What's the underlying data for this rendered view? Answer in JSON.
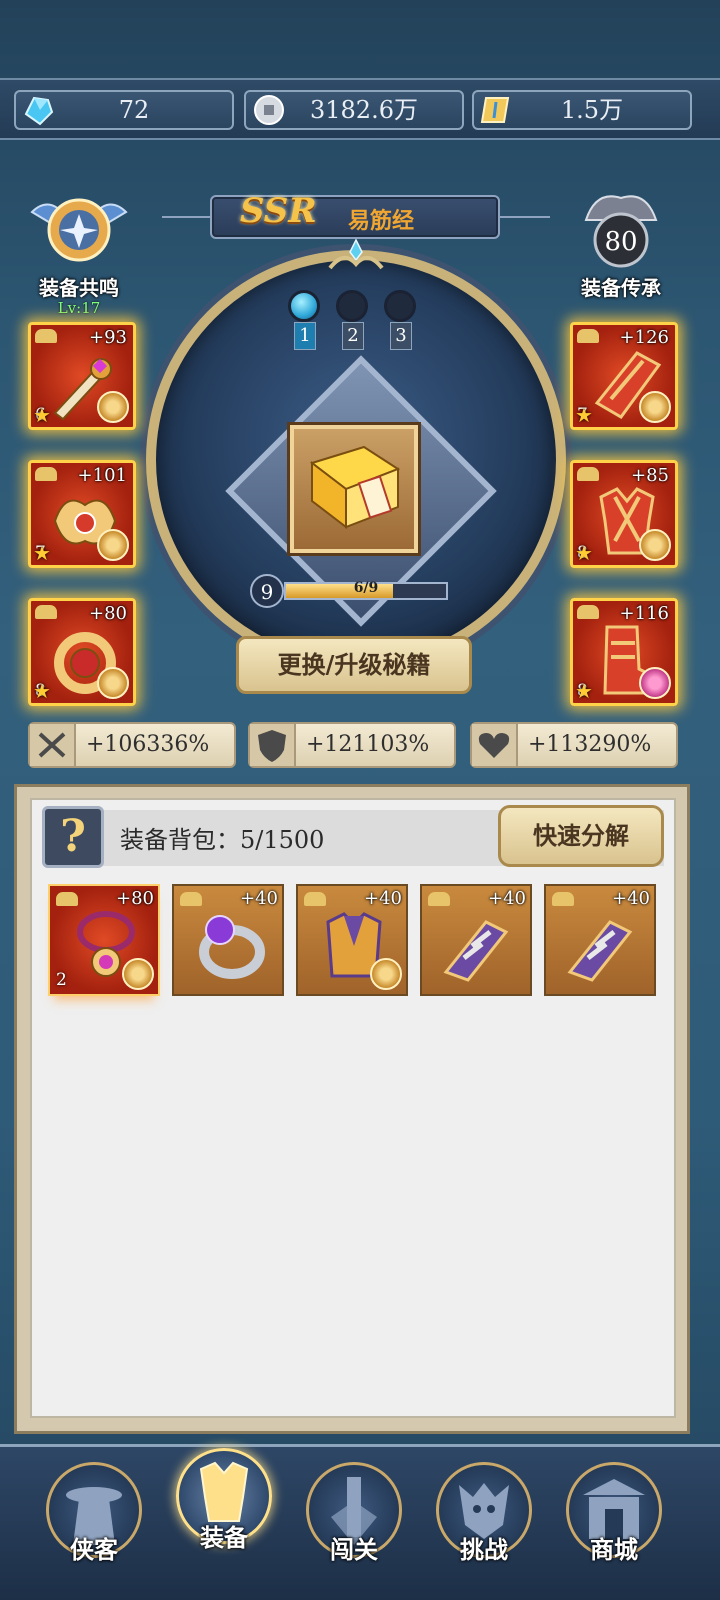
{
  "currencies": [
    {
      "icon": "blue-crystal-icon",
      "value": "72"
    },
    {
      "icon": "silver-coin-icon",
      "value": "3182.6万"
    },
    {
      "icon": "gold-scroll-icon",
      "value": "1.5万"
    }
  ],
  "header": {
    "rarity": "SSR",
    "name": "易筋经"
  },
  "left_badge": {
    "label": "装备共鸣",
    "level": "Lv:17"
  },
  "right_badge": {
    "value": "80",
    "label": "装备传承"
  },
  "slots_left": [
    {
      "plus": "+93",
      "star": "6",
      "icon": "sword-icon"
    },
    {
      "plus": "+101",
      "star": "7",
      "icon": "amulet-icon"
    },
    {
      "plus": "+80",
      "star": "8",
      "icon": "ring-icon"
    }
  ],
  "slots_right": [
    {
      "plus": "+126",
      "star": "7",
      "icon": "bracer-icon"
    },
    {
      "plus": "+85",
      "star": "8",
      "icon": "armor-icon"
    },
    {
      "plus": "+116",
      "star": "8",
      "icon": "boots-icon"
    }
  ],
  "gems": [
    {
      "num": "1",
      "active": true
    },
    {
      "num": "2",
      "active": false
    },
    {
      "num": "3",
      "active": false
    }
  ],
  "progress": {
    "level": "9",
    "text": "6/9",
    "fraction": 0.667
  },
  "upgrade_label": "更换/升级秘籍",
  "stats": [
    {
      "icon": "crossed-swords-icon",
      "value": "+106336%"
    },
    {
      "icon": "shield-icon",
      "value": "+121103%"
    },
    {
      "icon": "heart-icon",
      "value": "+113290%"
    }
  ],
  "bag": {
    "help": "?",
    "count_label": "装备背包：5/1500",
    "quick_label": "快速分解",
    "items": [
      {
        "plus": "+80",
        "star": "2",
        "icon": "necklace-icon"
      },
      {
        "plus": "+40",
        "icon": "purple-ring-icon"
      },
      {
        "plus": "+40",
        "icon": "robe-icon"
      },
      {
        "plus": "+40",
        "icon": "leg-guard-icon"
      },
      {
        "plus": "+40",
        "icon": "leg-guard-icon"
      }
    ]
  },
  "nav": [
    {
      "label": "侠客",
      "icon": "hero-icon"
    },
    {
      "label": "装备",
      "icon": "armor-icon",
      "active": true
    },
    {
      "label": "闯关",
      "icon": "tower-icon"
    },
    {
      "label": "挑战",
      "icon": "demon-icon"
    },
    {
      "label": "商城",
      "icon": "shop-gate-icon"
    }
  ]
}
